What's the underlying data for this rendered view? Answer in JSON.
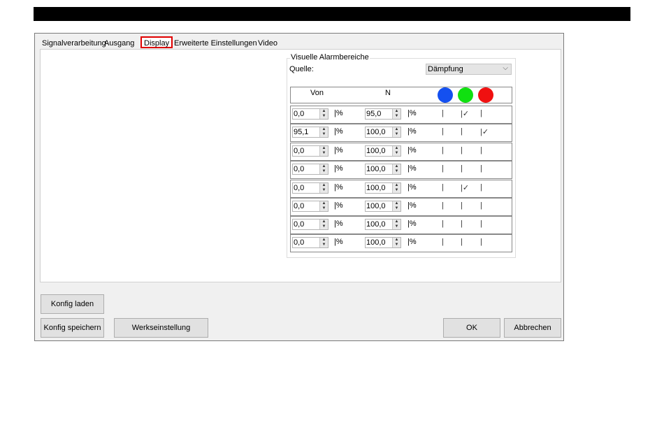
{
  "tabs": [
    "Signalverarbeitung",
    "Ausgang",
    "Display",
    "Erweiterte Einstellungen",
    "Video"
  ],
  "active_tab": "Display",
  "group": {
    "title": "Visuelle Alarmbereiche",
    "quelle_label": "Quelle:",
    "quelle_value": "Dämpfung"
  },
  "table": {
    "header_von": "Von",
    "header_n": "N",
    "colors": [
      "#1450f0",
      "#10e010",
      "#f01010"
    ],
    "unit": "|%",
    "rows": [
      {
        "von": "0,0",
        "n": "95,0",
        "checks": [
          "",
          "✓",
          ""
        ]
      },
      {
        "von": "95,1",
        "n": "100,0",
        "checks": [
          "",
          "",
          "✓"
        ]
      },
      {
        "von": "0,0",
        "n": "100,0",
        "checks": [
          "",
          "",
          ""
        ]
      },
      {
        "von": "0,0",
        "n": "100,0",
        "checks": [
          "",
          "",
          ""
        ]
      },
      {
        "von": "0,0",
        "n": "100,0",
        "checks": [
          "",
          "✓",
          ""
        ]
      },
      {
        "von": "0,0",
        "n": "100,0",
        "checks": [
          "",
          "",
          ""
        ]
      },
      {
        "von": "0,0",
        "n": "100,0",
        "checks": [
          "",
          "",
          ""
        ]
      },
      {
        "von": "0,0",
        "n": "100,0",
        "checks": [
          "",
          "",
          ""
        ]
      }
    ]
  },
  "buttons": {
    "load": "Konfig laden",
    "save": "Konfig speichern",
    "factory": "Werkseinstellung",
    "ok": "OK",
    "cancel": "Abbrechen"
  }
}
